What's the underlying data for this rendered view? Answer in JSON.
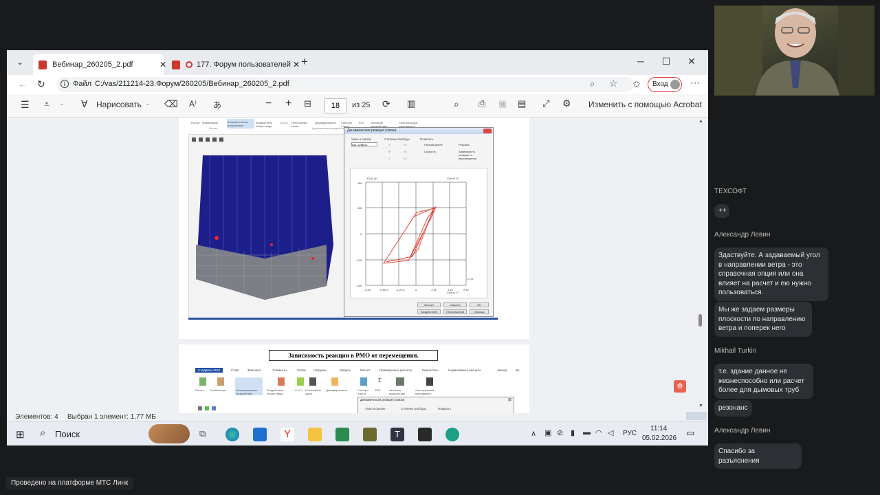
{
  "browser": {
    "tabs": [
      {
        "title": "Вебинар_260205_2.pdf",
        "active": true
      },
      {
        "title": "177. Форум пользователей",
        "active": false
      }
    ],
    "address_label": "Файл",
    "address_url": "C:/vas/211214-23.Форум/260205/Вебинар_260205_2.pdf",
    "signin_label": "Вход",
    "more_label": "⋯"
  },
  "pdf_toolbar": {
    "draw_label": "Нарисовать",
    "page_current": "18",
    "page_total": "из 25",
    "edit_label": "Изменить с помощью Acrobat"
  },
  "ribbon": {
    "items": [
      "Расчет",
      "Комбинации",
      "Кинематическое воздействие",
      "Воздействие общего вида",
      "А-Ч-Х",
      "Нелинейные связи",
      "Демпфирование",
      "Спектры ответа",
      "ЕЛЗ",
      "Активное воздействие",
      "Спектральный менеджмент"
    ],
    "group_left": "Расчет",
    "group_right": "Динамические воздействия"
  },
  "dialog": {
    "title": "Динамическая реакция (связи)",
    "col1_label": "Узлы в связях",
    "col1_value": "Ш3, 125БО1",
    "col2_label": "Степени свободы",
    "col2_options": [
      "X",
      "Y",
      "Z",
      "Rx",
      "Ry",
      "Rz"
    ],
    "col3_label": "Показать",
    "col3_options": [
      "Перемещение",
      "Скорость"
    ],
    "col4_options": [
      "Реакция",
      "Зависимость реакции от перемещения"
    ],
    "buttons": [
      "Экспорт",
      "Закрыть",
      "OK",
      "Воздействие",
      "Перемещения",
      "Помощь"
    ]
  },
  "chart_data": {
    "type": "line",
    "title": "",
    "ylabel": "F(U), кН",
    "xlabel": "U, м",
    "x_scale_label": "Xcm+1??",
    "y_top_label": "Xcm+1?4",
    "yticks": [
      "150",
      "100",
      "0",
      "-100",
      "-150"
    ],
    "xticks": [
      "-3.23",
      "-2.5e-2",
      "-1.2e-2",
      "0",
      "1.31",
      "1.12",
      "2.12"
    ],
    "grid": true
  },
  "page2": {
    "heading": "Зависимость реакции в РМО от перемещения.",
    "menu_items": [
      "СтаДиКон 2020",
      "Старт",
      "Фрагмент",
      "Элементы",
      "Связи",
      "Нагрузки",
      "Модель",
      "Расчет",
      "Приведенные расчеты",
      "Результаты",
      "Нормативные расчеты",
      "Вывод",
      "Ве"
    ],
    "ribbon_items": [
      "Расчет",
      "Комбинации",
      "Кинематическое воздействие",
      "Воздействие общего вида",
      "А-Ч-Х",
      "Нелинейные связи",
      "Демпфирование",
      "Спектры ответа",
      "ЕЛЗ",
      "Активное воздействие",
      "Спектральный менеджмент"
    ],
    "dialog_title": "Динамическая реакция (связи)",
    "dialog_cols": [
      "Узлы в связях",
      "Степени свободы",
      "Показать"
    ]
  },
  "status": {
    "elements": "Элементов: 4",
    "selected": "Выбран 1 элемент: 1,77 МБ"
  },
  "taskbar": {
    "search_label": "Поиск",
    "lang": "РУС",
    "time": "11:14",
    "date": "05.02.2026"
  },
  "chat": {
    "messages": [
      {
        "author": "ТЕХСОФТ",
        "texts": [
          "++"
        ]
      },
      {
        "author": "Александр Левин",
        "texts": [
          "Здаствуйте. А задаваемый угол в направлении ветра - это справочная опция или она влияет на расчет и ею нужно пользоваться.",
          "Мы же задаем размеры плоскости по направлению ветра и поперек него"
        ]
      },
      {
        "author": "Mikhail Turkin",
        "texts": [
          "т.е. здание данное не жизнеспособно или расчет более для  дымовых труб",
          "резонанс"
        ]
      },
      {
        "author": "Александр Левин",
        "texts": [
          "Спасибо за разъяснения"
        ]
      }
    ]
  },
  "footer_label": "Проведено на платформе МТС Линк",
  "colors": {
    "accent_red": "#e03a2f",
    "chat_bg": "#181a1b",
    "bubble_bg": "#2c2f33"
  }
}
